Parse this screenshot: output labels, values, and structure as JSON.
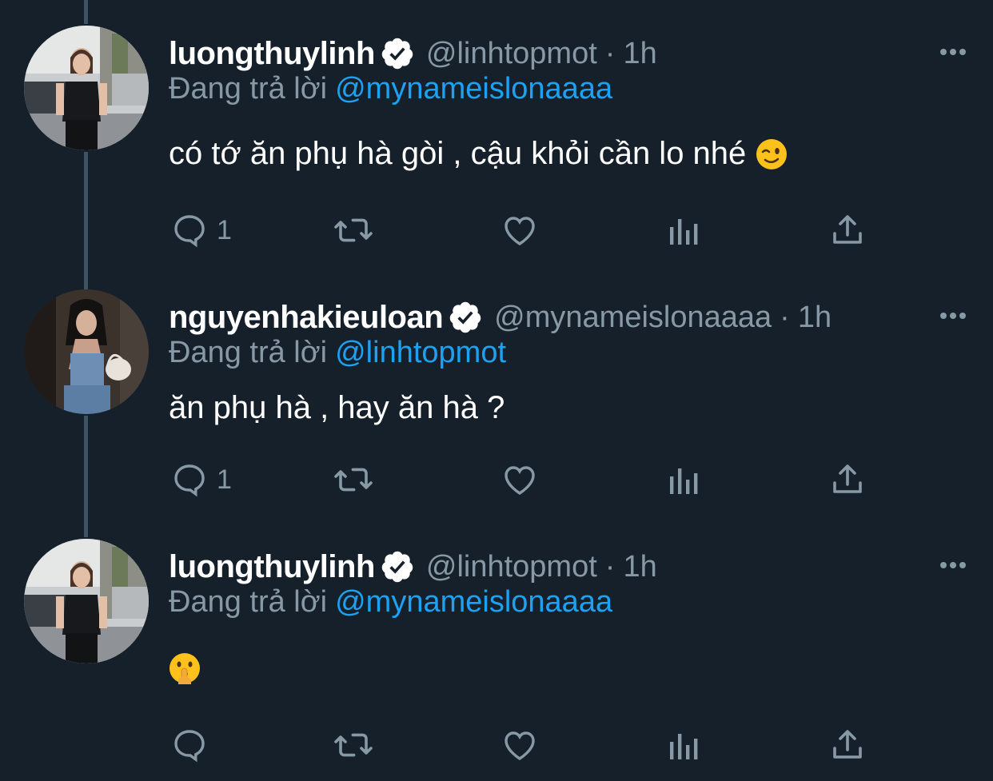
{
  "colors": {
    "background": "#15202b",
    "secondary_text": "#8899a6",
    "link": "#1da1f2",
    "thread_line": "#3d5466",
    "verified_badge": "#ffffff"
  },
  "tweets": [
    {
      "display_name": "luongthuylinh",
      "verified": true,
      "handle": "@linhtopmot",
      "separator": "·",
      "time": "1h",
      "reply_prefix": "Đang trả lời",
      "reply_to": "@mynameislonaaaa",
      "text": "có tớ ăn phụ hà gòi , cậu khỏi cần lo nhé",
      "emoji": "winking-face",
      "reply_count": "1"
    },
    {
      "display_name": "nguyenhakieuloan",
      "verified": true,
      "handle": "@mynameislonaaaa",
      "separator": "·",
      "time": "1h",
      "reply_prefix": "Đang trả lời",
      "reply_to": "@linhtopmot",
      "text": "ăn phụ hà , hay ăn hà ?",
      "reply_count": "1"
    },
    {
      "display_name": "luongthuylinh",
      "verified": true,
      "handle": "@linhtopmot",
      "separator": "·",
      "time": "1h",
      "reply_prefix": "Đang trả lời",
      "reply_to": "@mynameislonaaaa",
      "text": "",
      "emoji": "shushing-face",
      "reply_count": ""
    }
  ],
  "icons": {
    "reply": "comment-bubble-icon",
    "retweet": "retweet-icon",
    "like": "heart-icon",
    "analytics": "analytics-bars-icon",
    "share": "share-upload-icon",
    "more": "more-dots-icon",
    "verified": "verified-badge-icon"
  }
}
